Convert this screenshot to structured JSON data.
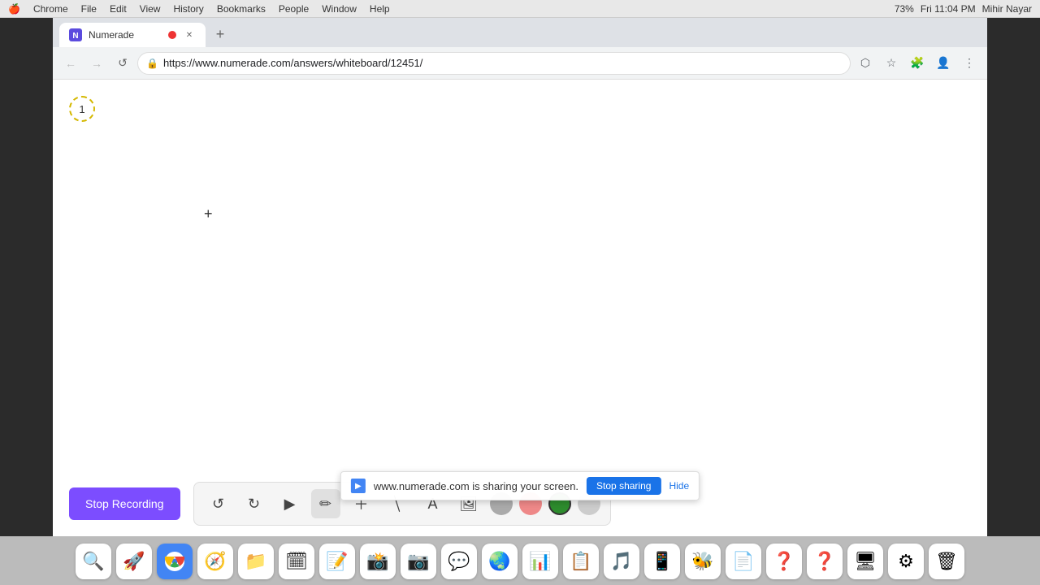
{
  "macbar": {
    "apple": "🍎",
    "menus": [
      "Chrome",
      "File",
      "Edit",
      "View",
      "History",
      "Bookmarks",
      "People",
      "Window",
      "Help"
    ],
    "battery": "73%",
    "time": "Fri 11:04 PM",
    "user": "Mihir Nayar"
  },
  "tab": {
    "title": "Numerade",
    "url": "https://www.numerade.com/answers/whiteboard/12451/",
    "new_tab_label": "+"
  },
  "nav": {
    "back_label": "←",
    "forward_label": "→",
    "reload_label": "↺"
  },
  "whiteboard": {
    "page_number": "1",
    "cursor": "+"
  },
  "toolbar": {
    "undo_label": "↺",
    "redo_label": "↻",
    "select_label": "▶",
    "pen_label": "✏",
    "add_label": "+",
    "eraser_label": "/",
    "text_label": "A",
    "image_label": "🖼",
    "colors": [
      "#aaa",
      "#e88",
      "#4c4",
      "#ccc"
    ],
    "active_color": "#4c4"
  },
  "stop_recording": {
    "label": "Stop Recording"
  },
  "sharing_bar": {
    "message": "www.numerade.com is sharing your screen.",
    "stop_label": "Stop sharing",
    "hide_label": "Hide"
  },
  "dock": {
    "items": [
      "🔍",
      "🚀",
      "🌐",
      "🧭",
      "📁",
      "🗓",
      "📝",
      "📸",
      "📷",
      "💬",
      "🌏",
      "📊",
      "📋",
      "🎵",
      "📱",
      "🐝",
      "📄",
      "❓",
      "❓",
      "🖥",
      "⚙",
      "🗑"
    ]
  }
}
